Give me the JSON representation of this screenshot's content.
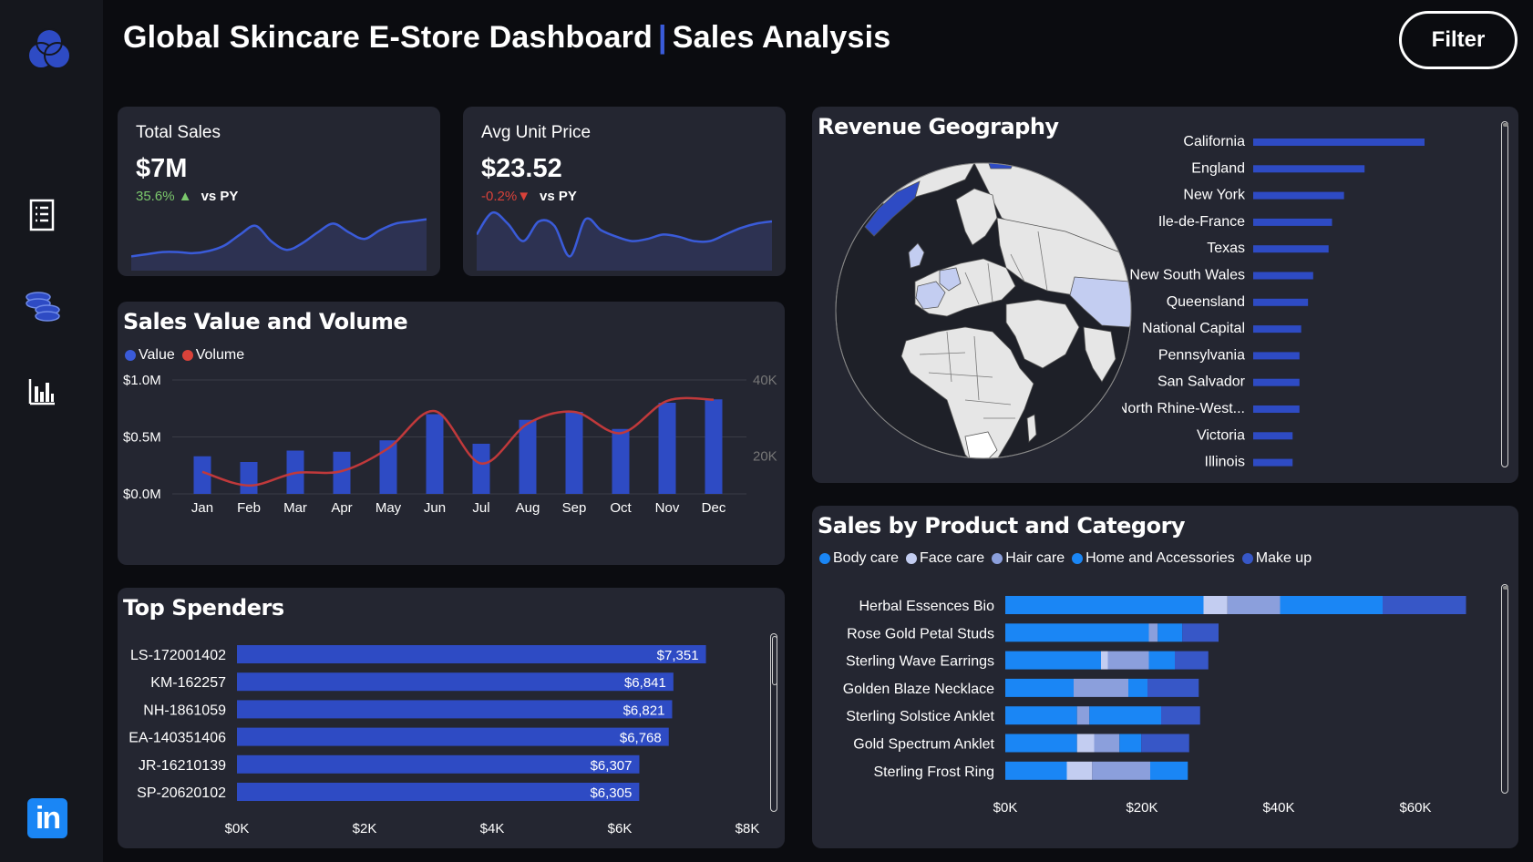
{
  "header": {
    "title_main": "Global Skincare E-Store Dashboard",
    "separator": "|",
    "title_sub": "Sales Analysis",
    "filter_label": "Filter"
  },
  "sidebar": {
    "icons": [
      "logo-icon",
      "report-icon",
      "coins-icon",
      "bar-chart-icon",
      "linkedin-icon"
    ]
  },
  "kpis": [
    {
      "label": "Total Sales",
      "value": "$7M",
      "delta": "35.6%",
      "delta_dir": "up",
      "vs": "vs PY",
      "spark": [
        8,
        10,
        12,
        12,
        11,
        13,
        18,
        28,
        36,
        22,
        14,
        20,
        30,
        38,
        30,
        24,
        32,
        38,
        40,
        42
      ]
    },
    {
      "label": "Avg Unit Price",
      "value": "$23.52",
      "delta": "-0.2%",
      "delta_dir": "down",
      "vs": "vs PY",
      "spark": [
        28,
        48,
        38,
        22,
        40,
        36,
        8,
        42,
        32,
        26,
        22,
        24,
        28,
        26,
        22,
        22,
        28,
        34,
        38,
        40
      ]
    }
  ],
  "colors": {
    "accent": "#3a5bd9",
    "bar_blue": "#2e4bc4",
    "line_red": "#c0393b",
    "card_bg": "#242631",
    "bright_blue": "#1a86f5",
    "light_blue": "#c3cdf1",
    "periwinkle": "#8b9fdc",
    "royal_blue": "#3757c7"
  },
  "sales_value_volume": {
    "title": "Sales Value and Volume",
    "legend": [
      {
        "name": "Value",
        "color": "#3a5bd9"
      },
      {
        "name": "Volume",
        "color": "#d9423a"
      }
    ]
  },
  "revenue_geography": {
    "title": "Revenue Geography"
  },
  "top_spenders": {
    "title": "Top Spenders"
  },
  "sales_by_product": {
    "title": "Sales by Product and Category"
  },
  "chart_data": [
    {
      "type": "bar",
      "title": "Sales Value and Volume",
      "categories": [
        "Jan",
        "Feb",
        "Mar",
        "Apr",
        "May",
        "Jun",
        "Jul",
        "Aug",
        "Sep",
        "Oct",
        "Nov",
        "Dec"
      ],
      "series": [
        {
          "name": "Value",
          "type": "bar",
          "axis": "left",
          "values": [
            0.33,
            0.28,
            0.38,
            0.37,
            0.47,
            0.7,
            0.44,
            0.65,
            0.72,
            0.57,
            0.8,
            0.83
          ]
        },
        {
          "name": "Volume",
          "type": "line",
          "axis": "right",
          "values": [
            15800,
            12200,
            15500,
            16000,
            22000,
            31800,
            18000,
            28500,
            31600,
            26000,
            34500,
            34800
          ]
        }
      ],
      "y_left": {
        "ticks": [
          "$0.0M",
          "$0.5M",
          "$1.0M"
        ],
        "range": [
          0,
          1.0
        ]
      },
      "y_right": {
        "ticks": [
          "20K",
          "40K"
        ],
        "range": [
          10000,
          40000
        ]
      },
      "grid": true,
      "legend_position": "top-left"
    },
    {
      "type": "bar",
      "title": "Revenue Geography",
      "orientation": "horizontal",
      "categories": [
        "California",
        "England",
        "New York",
        "Ile-de-France",
        "Texas",
        "New South Wales",
        "Queensland",
        "National Capital",
        "Pennsylvania",
        "San Salvador",
        "North Rhine-West...",
        "Victoria",
        "Illinois"
      ],
      "values": [
        100,
        65,
        53,
        46,
        44,
        35,
        32,
        28,
        27,
        27,
        27,
        23,
        23
      ]
    },
    {
      "type": "bar",
      "title": "Top Spenders",
      "orientation": "horizontal",
      "categories": [
        "LS-172001402",
        "KM-162257",
        "NH-1861059",
        "EA-140351406",
        "JR-16210139",
        "SP-20620102"
      ],
      "values": [
        7351,
        6841,
        6821,
        6768,
        6307,
        6305
      ],
      "value_labels": [
        "$7,351",
        "$6,841",
        "$6,821",
        "$6,768",
        "$6,307",
        "$6,305"
      ],
      "x_ticks": [
        "$0K",
        "$2K",
        "$4K",
        "$6K",
        "$8K"
      ],
      "xlim": [
        0,
        8000
      ]
    },
    {
      "type": "bar",
      "title": "Sales by Product and Category",
      "orientation": "horizontal",
      "stacked": true,
      "categories": [
        "Herbal Essences Bio",
        "Rose Gold Petal Studs",
        "Sterling Wave Earrings",
        "Golden Blaze Necklace",
        "Sterling Solstice Anklet",
        "Gold Spectrum Anklet",
        "Sterling Frost Ring"
      ],
      "series": [
        {
          "name": "Body care",
          "color": "#1a86f5",
          "values": [
            29000,
            21000,
            14000,
            10000,
            10500,
            10500,
            9000
          ]
        },
        {
          "name": "Face care",
          "color": "#c3cdf1",
          "values": [
            3500,
            0,
            1000,
            0,
            0,
            2500,
            3700
          ]
        },
        {
          "name": "Hair care",
          "color": "#8b9fdc",
          "values": [
            7700,
            1300,
            6000,
            8000,
            1800,
            3700,
            8500
          ]
        },
        {
          "name": "Home and Accessories",
          "color": "#1a86f5",
          "values": [
            15000,
            3600,
            3800,
            2800,
            10500,
            3200,
            5500
          ]
        },
        {
          "name": "Make up",
          "color": "#3757c7",
          "values": [
            12200,
            5300,
            4900,
            7500,
            5700,
            7000,
            0
          ]
        }
      ],
      "x_ticks": [
        "$0K",
        "$20K",
        "$40K",
        "$60K"
      ],
      "xlim": [
        0,
        60000
      ],
      "legend_position": "top-left"
    }
  ]
}
